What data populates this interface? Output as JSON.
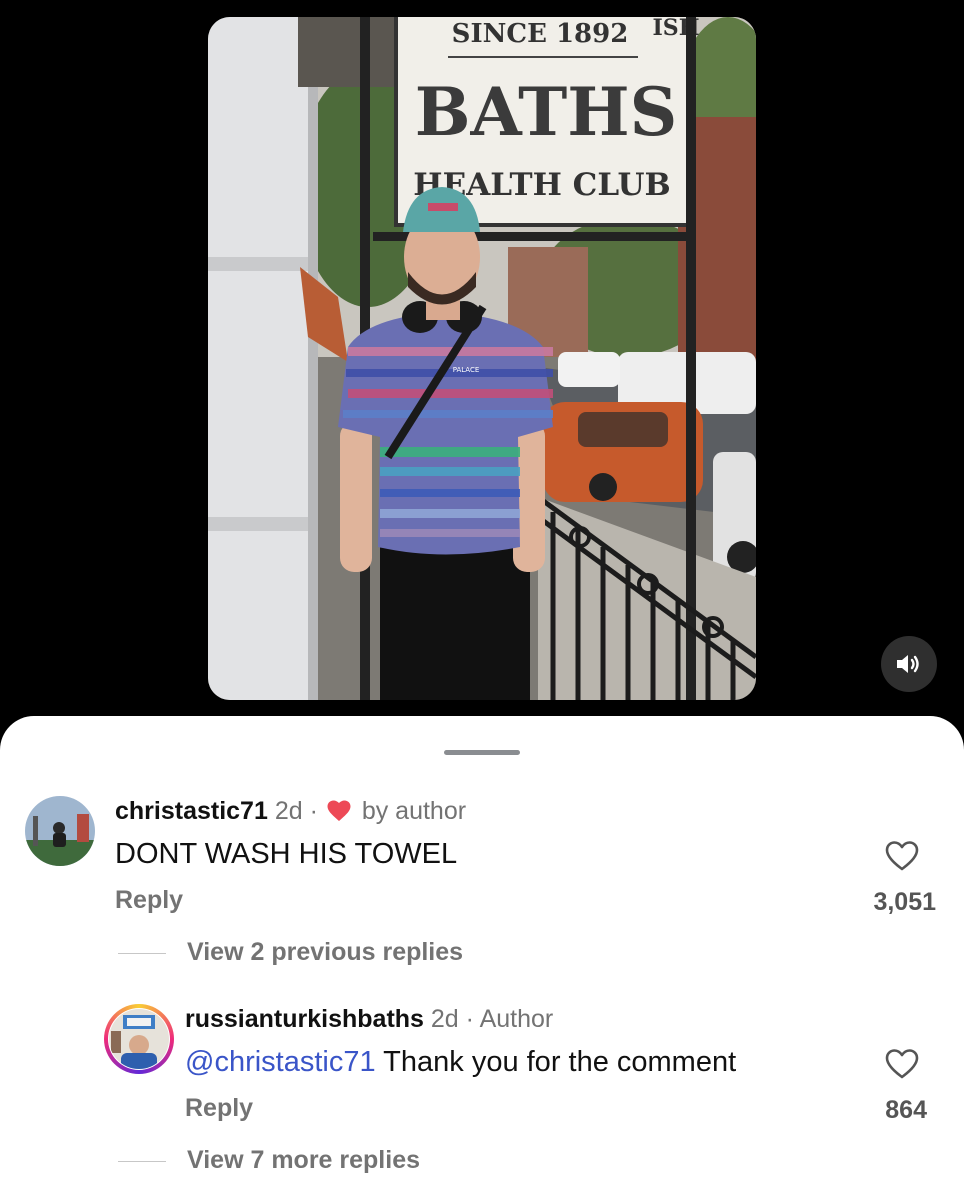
{
  "comments": [
    {
      "username": "christastic71",
      "time": "2d",
      "separator": "·",
      "liked_by_author_label": "by author",
      "text": "DONT WASH HIS TOWEL",
      "reply_label": "Reply",
      "likes": "3,051"
    },
    {
      "username": "russianturkishbaths",
      "time": "2d",
      "separator": "·",
      "role_label": "Author",
      "mention": "@christastic71",
      "text": " Thank you for the comment",
      "reply_label": "Reply",
      "likes": "864"
    }
  ],
  "view_replies": [
    "View 2 previous replies",
    "View 7 more replies"
  ],
  "video": {
    "sign_line1": "SINCE 1892",
    "sign_line2": "BATHS",
    "sign_line3": "HEALTH CLUB",
    "sign_top_fragment": "ISH",
    "shirt_logo": "PALACE",
    "mute_icon": "speaker-icon"
  },
  "colors": {
    "heart_red": "#ed4956",
    "mention_blue": "#3a55c8",
    "sheet_bg": "#ffffff"
  }
}
